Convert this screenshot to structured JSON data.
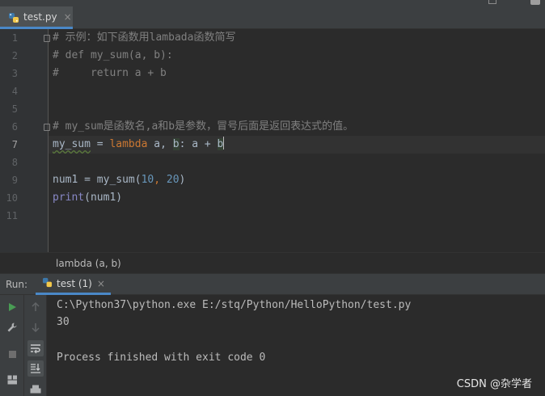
{
  "editor": {
    "tab": {
      "filename": "test.py",
      "close_glyph": "×"
    },
    "line_numbers": [
      "1",
      "2",
      "3",
      "4",
      "5",
      "6",
      "7",
      "8",
      "9",
      "10",
      "11"
    ],
    "active_line": "7",
    "lines": {
      "l1": "# 示例：如下函数用lambada函数简写",
      "l2": "# def my_sum(a, b):",
      "l3": "#     return a + b",
      "l6": "# my_sum是函数名,a和b是参数，冒号后面是返回表达式的值。",
      "l7": {
        "name": "my_sum",
        "eq": " = ",
        "kw": "lambda",
        "p1": " a, ",
        "p2": "b",
        "p3": ": a + ",
        "p4": "b"
      },
      "l9": {
        "lhs": "num1 = my_sum(",
        "n1": "10",
        "sep": ", ",
        "n2": "20",
        "rp": ")"
      },
      "l10": {
        "fn": "print",
        "args": "(num1)"
      }
    }
  },
  "breadcrumb": {
    "text": "lambda (a, b)"
  },
  "run": {
    "label": "Run:",
    "tab": {
      "name": "test (1)",
      "close_glyph": "×"
    },
    "console": [
      "C:\\Python37\\python.exe E:/stq/Python/HelloPython/test.py",
      "30",
      "",
      "Process finished with exit code 0"
    ]
  },
  "watermark": "CSDN @杂学者",
  "colors": {
    "accent_tab_underline": "#4a88c7",
    "run_green": "#499c54",
    "editor_bg": "#2b2b2b",
    "panel_bg": "#3c3f41"
  }
}
